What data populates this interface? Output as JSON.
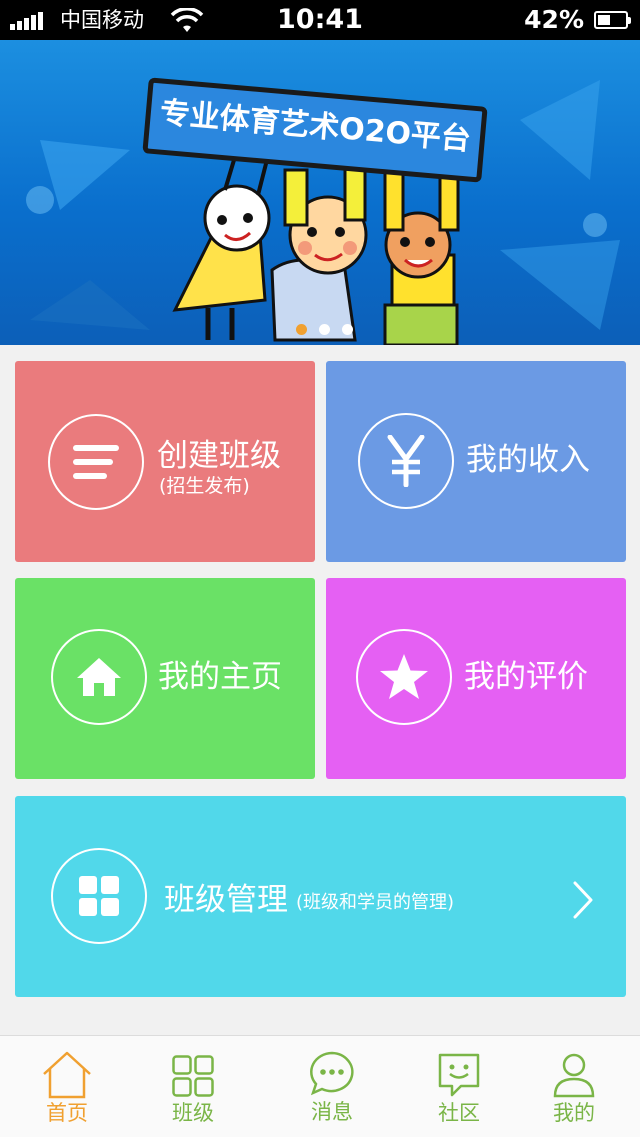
{
  "status_bar": {
    "carrier": "中国移动",
    "time": "10:41",
    "battery": "42%"
  },
  "banner": {
    "headline": "专业体育艺术O2O平台",
    "slides": 3,
    "active_slide": 1
  },
  "tiles": {
    "create_class": {
      "title": "创建班级",
      "subtitle": "(招生发布)",
      "icon": "list-icon",
      "color": "#ea7b7d"
    },
    "my_income": {
      "title": "我的收入",
      "icon": "yen-icon",
      "color": "#6b9ae4"
    },
    "my_homepage": {
      "title": "我的主页",
      "icon": "home-icon",
      "color": "#6ae166"
    },
    "my_reviews": {
      "title": "我的评价",
      "icon": "star-icon",
      "color": "#e560f3"
    },
    "class_management": {
      "title": "班级管理",
      "subtitle": "(班级和学员的管理)",
      "icon": "grid-icon",
      "color": "#51d8ea"
    }
  },
  "tabbar": {
    "items": [
      {
        "label": "首页",
        "icon": "home-outline-icon",
        "active": true
      },
      {
        "label": "班级",
        "icon": "grid-outline-icon",
        "active": false
      },
      {
        "label": "消息",
        "icon": "chat-bubble-icon",
        "active": false
      },
      {
        "label": "社区",
        "icon": "smiley-chat-icon",
        "active": false
      },
      {
        "label": "我的",
        "icon": "person-icon",
        "active": false
      }
    ],
    "active_color": "#f0a030",
    "inactive_color": "#7ab547"
  }
}
